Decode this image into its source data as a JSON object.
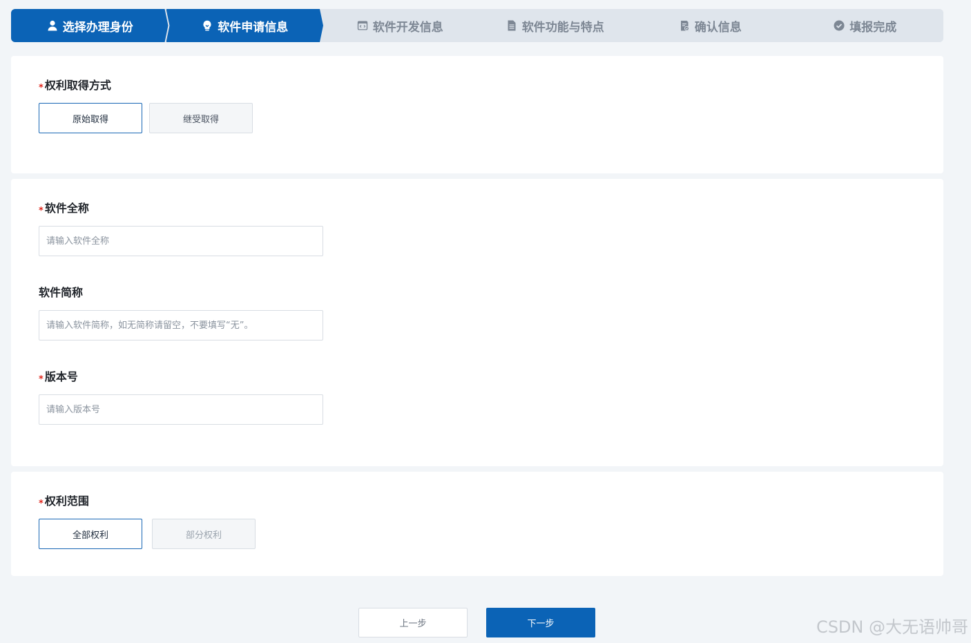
{
  "stepper": {
    "steps": [
      {
        "label": "选择办理身份",
        "icon": "user-icon",
        "state": "active"
      },
      {
        "label": "软件申请信息",
        "icon": "lightbulb-icon",
        "state": "active"
      },
      {
        "label": "软件开发信息",
        "icon": "code-window-icon",
        "state": "pending"
      },
      {
        "label": "软件功能与特点",
        "icon": "document-icon",
        "state": "pending"
      },
      {
        "label": "确认信息",
        "icon": "clipboard-check-icon",
        "state": "pending"
      },
      {
        "label": "填报完成",
        "icon": "check-circle-icon",
        "state": "pending"
      }
    ],
    "active_color": "#0b63b6",
    "pending_color": "#dfe5ec"
  },
  "rights_acquisition": {
    "required_mark": "*",
    "label": "权利取得方式",
    "options": [
      {
        "label": "原始取得",
        "selected": true
      },
      {
        "label": "继受取得",
        "selected": false
      }
    ]
  },
  "software_info": {
    "full_name": {
      "required_mark": "*",
      "label": "软件全称",
      "value": "",
      "placeholder": "请输入软件全称"
    },
    "short_name": {
      "label": "软件简称",
      "value": "",
      "placeholder": "请输入软件简称，如无简称请留空，不要填写“无”。"
    },
    "version": {
      "required_mark": "*",
      "label": "版本号",
      "value": "",
      "placeholder": "请输入版本号"
    }
  },
  "rights_scope": {
    "required_mark": "*",
    "label": "权利范围",
    "options": [
      {
        "label": "全部权利",
        "selected": true,
        "disabled": false
      },
      {
        "label": "部分权利",
        "selected": false,
        "disabled": true
      }
    ]
  },
  "footer": {
    "prev_label": "上一步",
    "next_label": "下一步"
  },
  "watermark": "CSDN @大无语帅哥"
}
